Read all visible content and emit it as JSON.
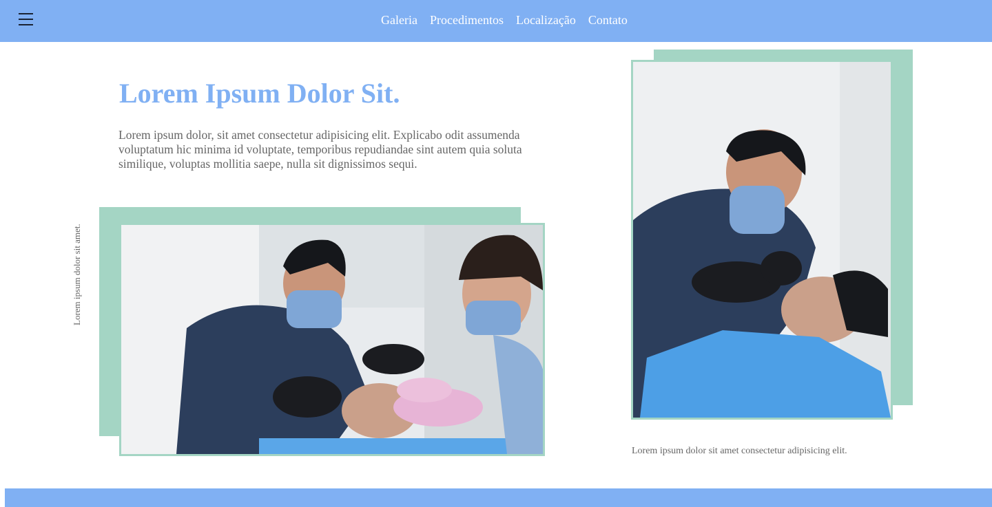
{
  "nav": {
    "links": [
      "Galeria",
      "Procedimentos",
      "Localização",
      "Contato"
    ]
  },
  "hero": {
    "title": "Lorem Ipsum Dolor Sit.",
    "text": "Lorem ipsum dolor, sit amet consectetur adipisicing elit. Explicabo odit assumenda voluptatum hic minima id voluptate, temporibus repudiandae sint autem quia soluta similique, voluptas mollitia saepe, nulla sit dignissimos sequi."
  },
  "gallery": {
    "vertical_caption": "Lorem ipsum dolor sit amet.",
    "right_caption": "Lorem ipsum dolor sit amet consectetur adipisicing elit."
  },
  "colors": {
    "primary_blue": "#80b0f3",
    "accent_green": "#a4d5c4",
    "text_gray": "#666666"
  },
  "icons": {
    "menu": "hamburger-menu-icon"
  }
}
